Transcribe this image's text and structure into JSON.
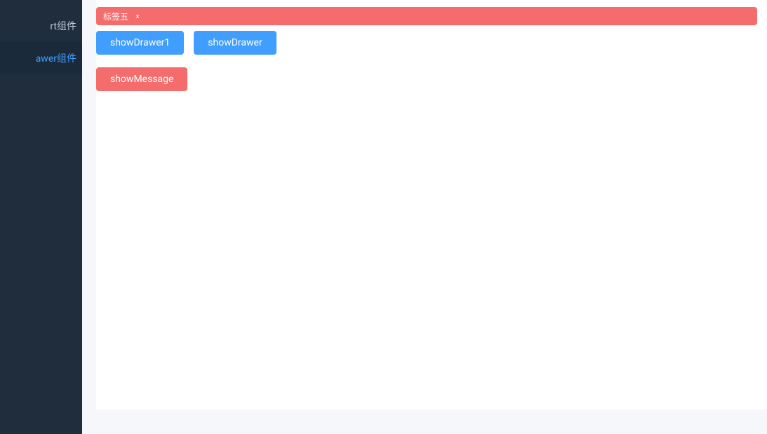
{
  "sidebar": {
    "items": [
      {
        "label": "rt组件"
      },
      {
        "label": "awer组件"
      }
    ],
    "activeIndex": 1
  },
  "tag": {
    "label": "标签五",
    "closeGlyph": "×"
  },
  "buttons": {
    "row1": [
      {
        "label": "showDrawer1",
        "variant": "primary"
      },
      {
        "label": "showDrawer",
        "variant": "primary"
      }
    ],
    "row2": [
      {
        "label": "showMessage",
        "variant": "danger"
      }
    ]
  },
  "colors": {
    "sidebarBg": "#1f2d3d",
    "accent": "#409eff",
    "danger": "#f56c6c",
    "pageBg": "#f5f7fa"
  }
}
